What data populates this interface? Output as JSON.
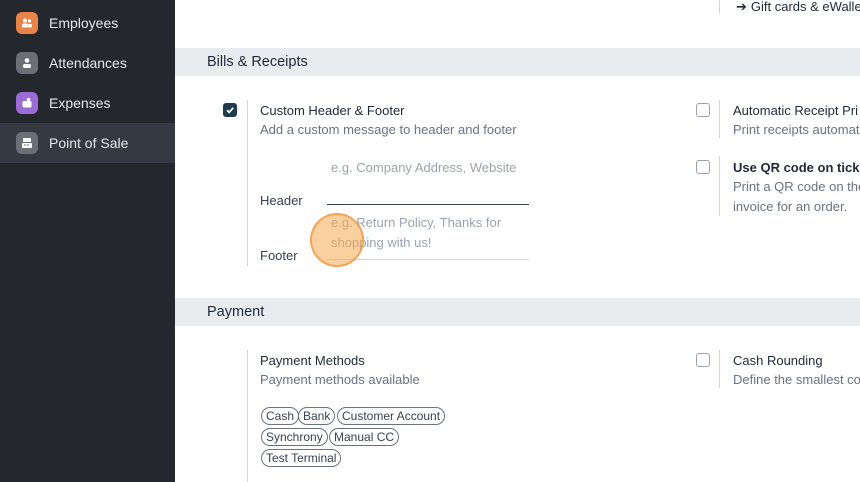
{
  "sidebar": {
    "items": [
      {
        "label": "Employees",
        "icon": "employees-icon",
        "color": "#e8834a"
      },
      {
        "label": "Attendances",
        "icon": "attendances-icon",
        "color": "#6b6f76"
      },
      {
        "label": "Expenses",
        "icon": "expenses-icon",
        "color": "#9b6bd6"
      },
      {
        "label": "Point of Sale",
        "icon": "point-of-sale-icon",
        "color": "#6b6f76"
      }
    ]
  },
  "top_link": {
    "arrow": "➔",
    "label": "Gift cards & eWalle"
  },
  "bills": {
    "title": "Bills & Receipts",
    "header_footer": {
      "title": "Custom Header & Footer",
      "desc": "Add a custom message to header and footer",
      "header_label": "Header",
      "header_placeholder": "e.g. Company Address, Website",
      "footer_label": "Footer",
      "footer_placeholder": "e.g. Return Policy, Thanks for shopping with us!"
    },
    "auto_print": {
      "title": "Automatic Receipt Pri",
      "desc": "Print receipts automat"
    },
    "qr": {
      "title": "Use QR code on ticke",
      "desc_line1": "Print a QR code on the",
      "desc_line2": "invoice for an order."
    }
  },
  "payment": {
    "title": "Payment",
    "methods": {
      "title": "Payment Methods",
      "desc": "Payment methods available",
      "tags": [
        "Cash",
        "Bank",
        "Customer Account",
        "Synchrony",
        "Manual CC",
        "Test Terminal"
      ]
    },
    "rounding": {
      "title": "Cash Rounding",
      "desc": "Define the smallest co"
    }
  },
  "colors": {
    "sidebar_bg": "#24272c",
    "section_bg": "#e9ecef",
    "checkbox_checked": "#1f3b4d"
  }
}
